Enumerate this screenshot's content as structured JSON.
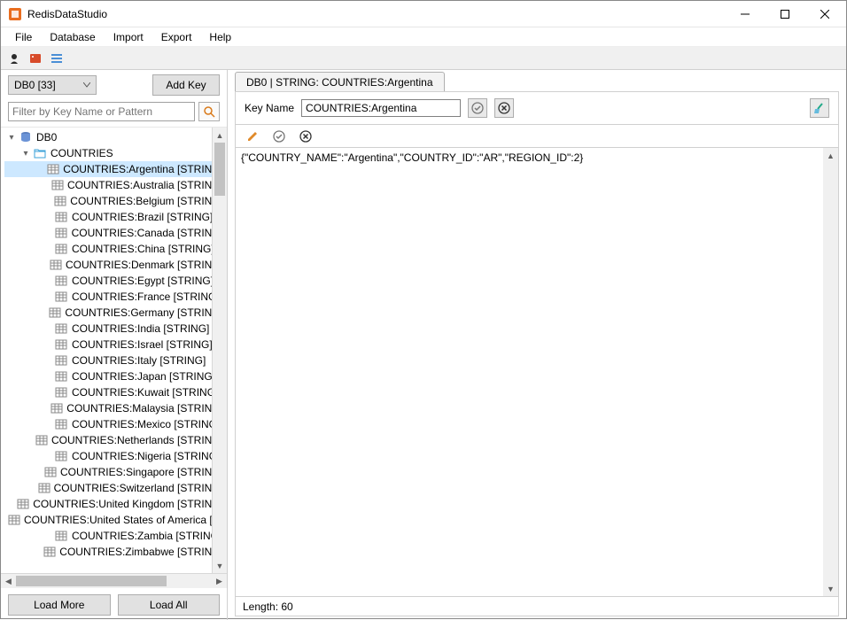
{
  "window": {
    "title": "RedisDataStudio"
  },
  "menu": {
    "items": [
      "File",
      "Database",
      "Import",
      "Export",
      "Help"
    ]
  },
  "sidebar": {
    "db_selector": "DB0 [33]",
    "add_key_label": "Add Key",
    "filter_placeholder": "Filter by Key Name or Pattern",
    "load_more_label": "Load More",
    "load_all_label": "Load All",
    "tree": {
      "root": "DB0",
      "group": "COUNTRIES",
      "keys": [
        {
          "label": "COUNTRIES:Argentina [STRING]",
          "selected": true
        },
        {
          "label": "COUNTRIES:Australia [STRING]"
        },
        {
          "label": "COUNTRIES:Belgium [STRING]"
        },
        {
          "label": "COUNTRIES:Brazil [STRING]"
        },
        {
          "label": "COUNTRIES:Canada [STRING]"
        },
        {
          "label": "COUNTRIES:China [STRING]"
        },
        {
          "label": "COUNTRIES:Denmark [STRING]"
        },
        {
          "label": "COUNTRIES:Egypt [STRING]"
        },
        {
          "label": "COUNTRIES:France [STRING]"
        },
        {
          "label": "COUNTRIES:Germany [STRING]"
        },
        {
          "label": "COUNTRIES:India [STRING]"
        },
        {
          "label": "COUNTRIES:Israel [STRING]"
        },
        {
          "label": "COUNTRIES:Italy [STRING]"
        },
        {
          "label": "COUNTRIES:Japan [STRING]"
        },
        {
          "label": "COUNTRIES:Kuwait [STRING]"
        },
        {
          "label": "COUNTRIES:Malaysia [STRING]"
        },
        {
          "label": "COUNTRIES:Mexico [STRING]"
        },
        {
          "label": "COUNTRIES:Netherlands [STRING]"
        },
        {
          "label": "COUNTRIES:Nigeria [STRING]"
        },
        {
          "label": "COUNTRIES:Singapore [STRING]"
        },
        {
          "label": "COUNTRIES:Switzerland [STRING]"
        },
        {
          "label": "COUNTRIES:United Kingdom [STRING]"
        },
        {
          "label": "COUNTRIES:United States of America [STRING]"
        },
        {
          "label": "COUNTRIES:Zambia [STRING]"
        },
        {
          "label": "COUNTRIES:Zimbabwe [STRING]"
        }
      ]
    }
  },
  "tab": {
    "title": "DB0 | STRING: COUNTRIES:Argentina"
  },
  "detail": {
    "keyname_label": "Key Name",
    "keyname_value": "COUNTRIES:Argentina",
    "value_text": "{\"COUNTRY_NAME\":\"Argentina\",\"COUNTRY_ID\":\"AR\",\"REGION_ID\":2}",
    "status": "Length: 60"
  }
}
